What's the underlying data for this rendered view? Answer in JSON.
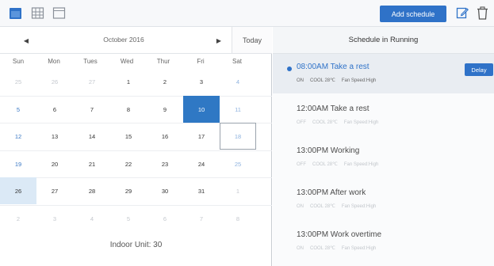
{
  "toolbar": {
    "icons": [
      "calendar-icon",
      "grid-icon",
      "blank-calendar-icon",
      "edit-icon",
      "trash-icon"
    ],
    "add_schedule_label": "Add schedule"
  },
  "calendar": {
    "prev": "◀",
    "next": "▶",
    "month_label": "October 2016",
    "today_label": "Today",
    "weekdays": [
      "Sun",
      "Mon",
      "Tues",
      "Wed",
      "Thur",
      "Fri",
      "Sat"
    ],
    "weeks": [
      [
        "25",
        "26",
        "27",
        "1",
        "2",
        "3",
        "4"
      ],
      [
        "5",
        "6",
        "7",
        "8",
        "9",
        "10",
        "11"
      ],
      [
        "12",
        "13",
        "14",
        "15",
        "16",
        "17",
        "18"
      ],
      [
        "19",
        "20",
        "21",
        "22",
        "23",
        "24",
        "25"
      ],
      [
        "26",
        "27",
        "28",
        "29",
        "30",
        "31",
        "1"
      ],
      [
        "2",
        "3",
        "4",
        "5",
        "6",
        "7",
        "8"
      ]
    ],
    "selected_date": "10",
    "today_date": "18",
    "indoor_label": "Indoor Unit: 30"
  },
  "schedule": {
    "header": "Schedule in Running",
    "delay_label": "Delay",
    "items": [
      {
        "title": "08:00AM Take a rest",
        "power": "ON",
        "mode": "COOL 28℃",
        "fan": "Fan Speed:High",
        "active": true
      },
      {
        "title": "12:00AM Take a rest",
        "power": "OFF",
        "mode": "COOL 28℃",
        "fan": "Fan Speed:High",
        "active": false
      },
      {
        "title": "13:00PM Working",
        "power": "OFF",
        "mode": "COOL 28℃",
        "fan": "Fan Speed:High",
        "active": false
      },
      {
        "title": "13:00PM After work",
        "power": "ON",
        "mode": "COOL 28℃",
        "fan": "Fan Speed:High",
        "active": false
      },
      {
        "title": "13:00PM Work overtime",
        "power": "ON",
        "mode": "COOL 28℃",
        "fan": "Fan Speed:High",
        "active": false
      }
    ]
  },
  "colors": {
    "accent": "#2f72c8",
    "selected_day": "#2f78c4",
    "light_day": "#dbe9f6"
  }
}
